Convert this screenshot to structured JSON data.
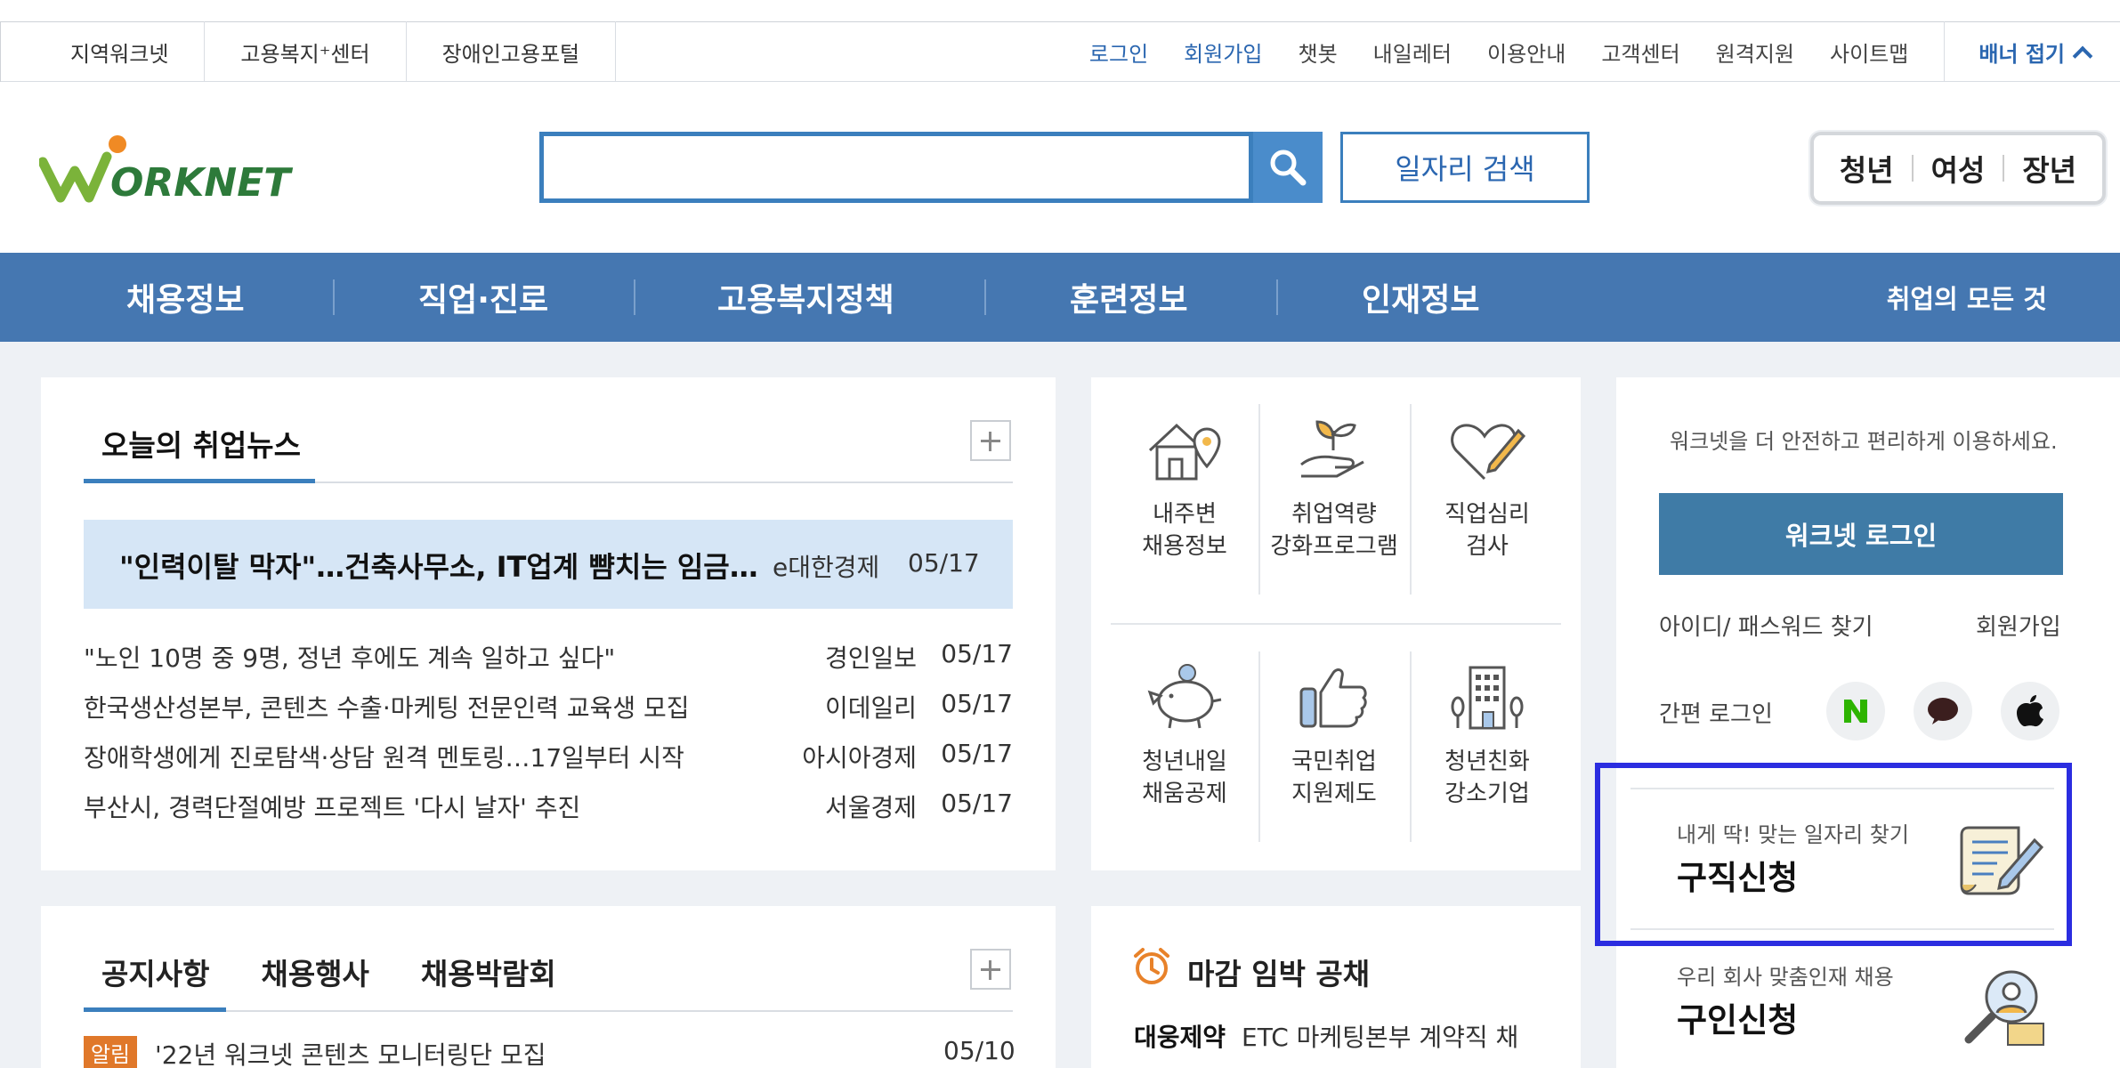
{
  "util": {
    "left": [
      "지역워크넷",
      "고용복지⁺센터",
      "장애인고용포털"
    ],
    "right": [
      {
        "label": "로그인",
        "accent": true
      },
      {
        "label": "회원가입",
        "accent": true
      },
      {
        "label": "챗봇",
        "accent": false
      },
      {
        "label": "내일레터",
        "accent": false
      },
      {
        "label": "이용안내",
        "accent": false
      },
      {
        "label": "고객센터",
        "accent": false
      },
      {
        "label": "원격지원",
        "accent": false
      },
      {
        "label": "사이트맵",
        "accent": false
      }
    ],
    "fold": "배너 접기"
  },
  "header": {
    "search_placeholder": "",
    "job_search": "일자리 검색",
    "age_groups": [
      "청년",
      "여성",
      "장년"
    ]
  },
  "nav": {
    "menus": [
      "채용정보",
      "직업·진로",
      "고용복지정책",
      "훈련정보",
      "인재정보"
    ],
    "all": "취업의 모든 것"
  },
  "news": {
    "title": "오늘의 취업뉴스",
    "headline": {
      "title": "\"인력이탈 막자\"…건축사무소, IT업계 뺨치는 임금…",
      "source": "e대한경제",
      "date": "05/17"
    },
    "items": [
      {
        "title": "\"노인 10명 중 9명, 정년 후에도 계속 일하고 싶다\"",
        "source": "경인일보",
        "date": "05/17"
      },
      {
        "title": "한국생산성본부, 콘텐츠 수출·마케팅 전문인력 교육생 모집",
        "source": "이데일리",
        "date": "05/17"
      },
      {
        "title": "장애학생에게 진로탐색·상담 원격 멘토링…17일부터 시작",
        "source": "아시아경제",
        "date": "05/17"
      },
      {
        "title": "부산시, 경력단절예방 프로젝트 '다시 날자' 추진",
        "source": "서울경제",
        "date": "05/17"
      }
    ]
  },
  "quick": [
    {
      "l1": "내주변",
      "l2": "채용정보",
      "icon": "house-pin-icon"
    },
    {
      "l1": "취업역량",
      "l2": "강화프로그램",
      "icon": "sprout-hand-icon"
    },
    {
      "l1": "직업심리",
      "l2": "검사",
      "icon": "heart-pencil-icon"
    },
    {
      "l1": "청년내일",
      "l2": "채움공제",
      "icon": "piggy-bank-icon"
    },
    {
      "l1": "국민취업",
      "l2": "지원제도",
      "icon": "thumbs-up-icon"
    },
    {
      "l1": "청년친화",
      "l2": "강소기업",
      "icon": "building-icon"
    }
  ],
  "login": {
    "message": "워크넷을 더 안전하고 편리하게 이용하세요.",
    "button": "워크넷 로그인",
    "find": "아이디/ 패스워드 찾기",
    "join": "회원가입",
    "easy": "간편 로그인",
    "social": [
      "naver-icon",
      "kakao-icon",
      "apple-icon"
    ]
  },
  "apply": {
    "sub": "내게 딱! 맞는 일자리 찾기",
    "main": "구직신청"
  },
  "hire": {
    "sub": "우리 회사 맞춤인재 채용",
    "main": "구인신청"
  },
  "notice": {
    "tabs": [
      "공지사항",
      "채용행사",
      "채용박람회"
    ],
    "badge": "알림",
    "text": "'22년 워크넷 콘텐츠 모니터링단 모집",
    "date": "05/10"
  },
  "deadline": {
    "title": "마감 임박 공채",
    "company": "대웅제약",
    "job": "ETC 마케팅본부 계약직 채"
  },
  "colors": {
    "brand": "#4577b1",
    "accent": "#2a66b0",
    "highlight": "#2b2de0",
    "badge": "#e0782a"
  }
}
